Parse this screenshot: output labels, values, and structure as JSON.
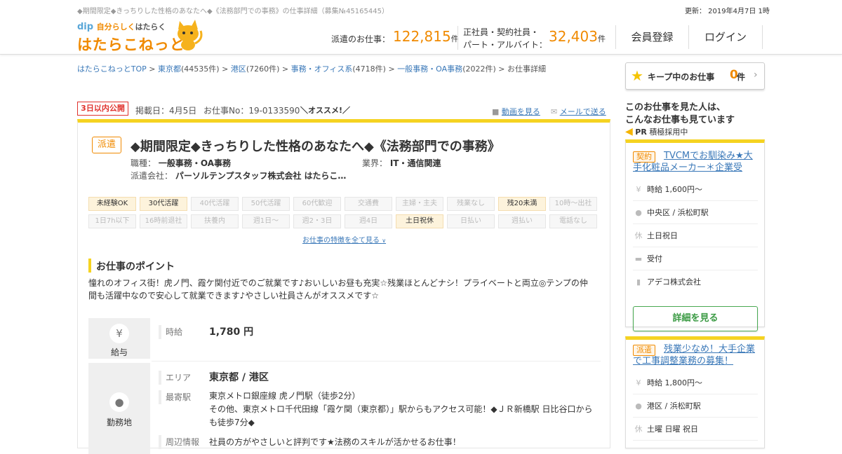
{
  "header": {
    "top_left": "◆期間限定◆きっちりした性格のあなたへ◆《法務部門での事務》の仕事詳細（募集№45165445）",
    "updated": "更新： 2019年4月7日 1時",
    "logo_top_dip": "dip",
    "logo_top_a": "自分らしく",
    "logo_top_b": "はたらく",
    "logo_main": "はたらこねっと",
    "stat1_label": "派遣のお仕事：",
    "stat1_num": "122,815",
    "stat1_unit": "件",
    "stat2_label1": "正社員・契約社員・",
    "stat2_label2": "パート・アルバイト：",
    "stat2_num": "32,403",
    "stat2_unit": "件",
    "register": "会員登録",
    "login": "ログイン"
  },
  "breadcrumb": {
    "items": [
      {
        "link": "はたらこねっとTOP",
        "count": ""
      },
      {
        "link": "東京都",
        "count": "(44535件)"
      },
      {
        "link": "港区",
        "count": "(7260件)"
      },
      {
        "link": "事務・オフィス系",
        "count": "(4718件)"
      },
      {
        "link": "一般事務・OA事務",
        "count": "(2022件)"
      }
    ],
    "current": "お仕事詳細",
    "sep": ">"
  },
  "keep": {
    "label": "キープ中のお仕事",
    "count": "0",
    "unit": "件"
  },
  "job": {
    "new_badge": "3日以内公開",
    "posted": "掲載日：4月5日",
    "job_no": "お仕事No：19-0133590",
    "recommend": "＼オススメ!／",
    "video": "動画を見る",
    "mail": "メールで送る",
    "type_badge": "派遣",
    "title": "◆期間限定◆きっちりした性格のあなたへ◆《法務部門での事務》",
    "occupation_label": "職種：",
    "occupation": "一般事務・OA事務",
    "industry_label": "業界：",
    "industry": "IT・通信関連",
    "company_label": "派遣会社：",
    "company": "パーソルテンプスタッフ株式会社 はたらこ…",
    "tags": [
      {
        "label": "未経験OK",
        "on": true
      },
      {
        "label": "30代活躍",
        "on": true
      },
      {
        "label": "40代活躍",
        "on": false
      },
      {
        "label": "50代活躍",
        "on": false
      },
      {
        "label": "60代歓迎",
        "on": false
      },
      {
        "label": "交通費",
        "on": false
      },
      {
        "label": "主婦・主夫",
        "on": false
      },
      {
        "label": "残業なし",
        "on": false
      },
      {
        "label": "残20未満",
        "on": true
      },
      {
        "label": "10時～出社",
        "on": false
      },
      {
        "label": "1日7h以下",
        "on": false
      },
      {
        "label": "16時前退社",
        "on": false
      },
      {
        "label": "扶養内",
        "on": false
      },
      {
        "label": "週1日～",
        "on": false
      },
      {
        "label": "週2・3日",
        "on": false
      },
      {
        "label": "週4日",
        "on": false
      },
      {
        "label": "土日祝休",
        "on": true
      },
      {
        "label": "日払い",
        "on": false
      },
      {
        "label": "週払い",
        "on": false
      },
      {
        "label": "電話なし",
        "on": false
      }
    ],
    "all_features": "お仕事の特徴を全て見る",
    "point_title": "お仕事のポイント",
    "point_body": "憧れのオフィス街！虎ノ門、霞ケ関付近でのご就業です♪おいしいお昼も充実☆残業ほとんどナシ！プライベートと両立◎テンプの仲間も活躍中なので安心して就業できます♪やさしい社員さんがオススメです☆",
    "salary_section": "給与",
    "salary_label": "時給",
    "salary_value": "1,780 円",
    "location_section": "勤務地",
    "area_label": "エリア",
    "area_value": "東京都 / 港区",
    "station_label": "最寄駅",
    "station_value1": "東京メトロ銀座線 虎ノ門駅（徒歩2分）",
    "station_value2": "その他、東京メトロ千代田線「霞ケ関（東京都）」駅からもアクセス可能！◆ＪＲ新橋駅 日比谷口からも徒歩7分◆",
    "around_label": "周辺情報",
    "around_value": "社員の方がやさしいと評判です★法務のスキルが活かせるお仕事！"
  },
  "sidebar": {
    "heading1": "このお仕事を見た人は、",
    "heading2": "こんなお仕事も見ています",
    "pr": "PR",
    "pr_text": "積極採用中",
    "card1": {
      "kind": "契約",
      "title": "TVCMでお馴染み★大手化粧品メーカー＊企業受",
      "wage": "時給 1,600円～",
      "place": "中央区 / 浜松町駅",
      "holiday": "土日祝日",
      "job": "受付",
      "company": "アデコ株式会社",
      "button": "詳細を見る"
    },
    "card2": {
      "kind": "派遣",
      "title": "残業少なめ！大手企業で工事調整業務の募集！",
      "wage": "時給 1,800円～",
      "place": "港区 / 浜松町駅",
      "holiday": "土曜 日曜 祝日"
    }
  },
  "colors": {
    "accent": "#f08a00",
    "yellow": "#f5d321",
    "link": "#3a78b8",
    "green": "#3a9a43",
    "red": "#e0322d"
  }
}
